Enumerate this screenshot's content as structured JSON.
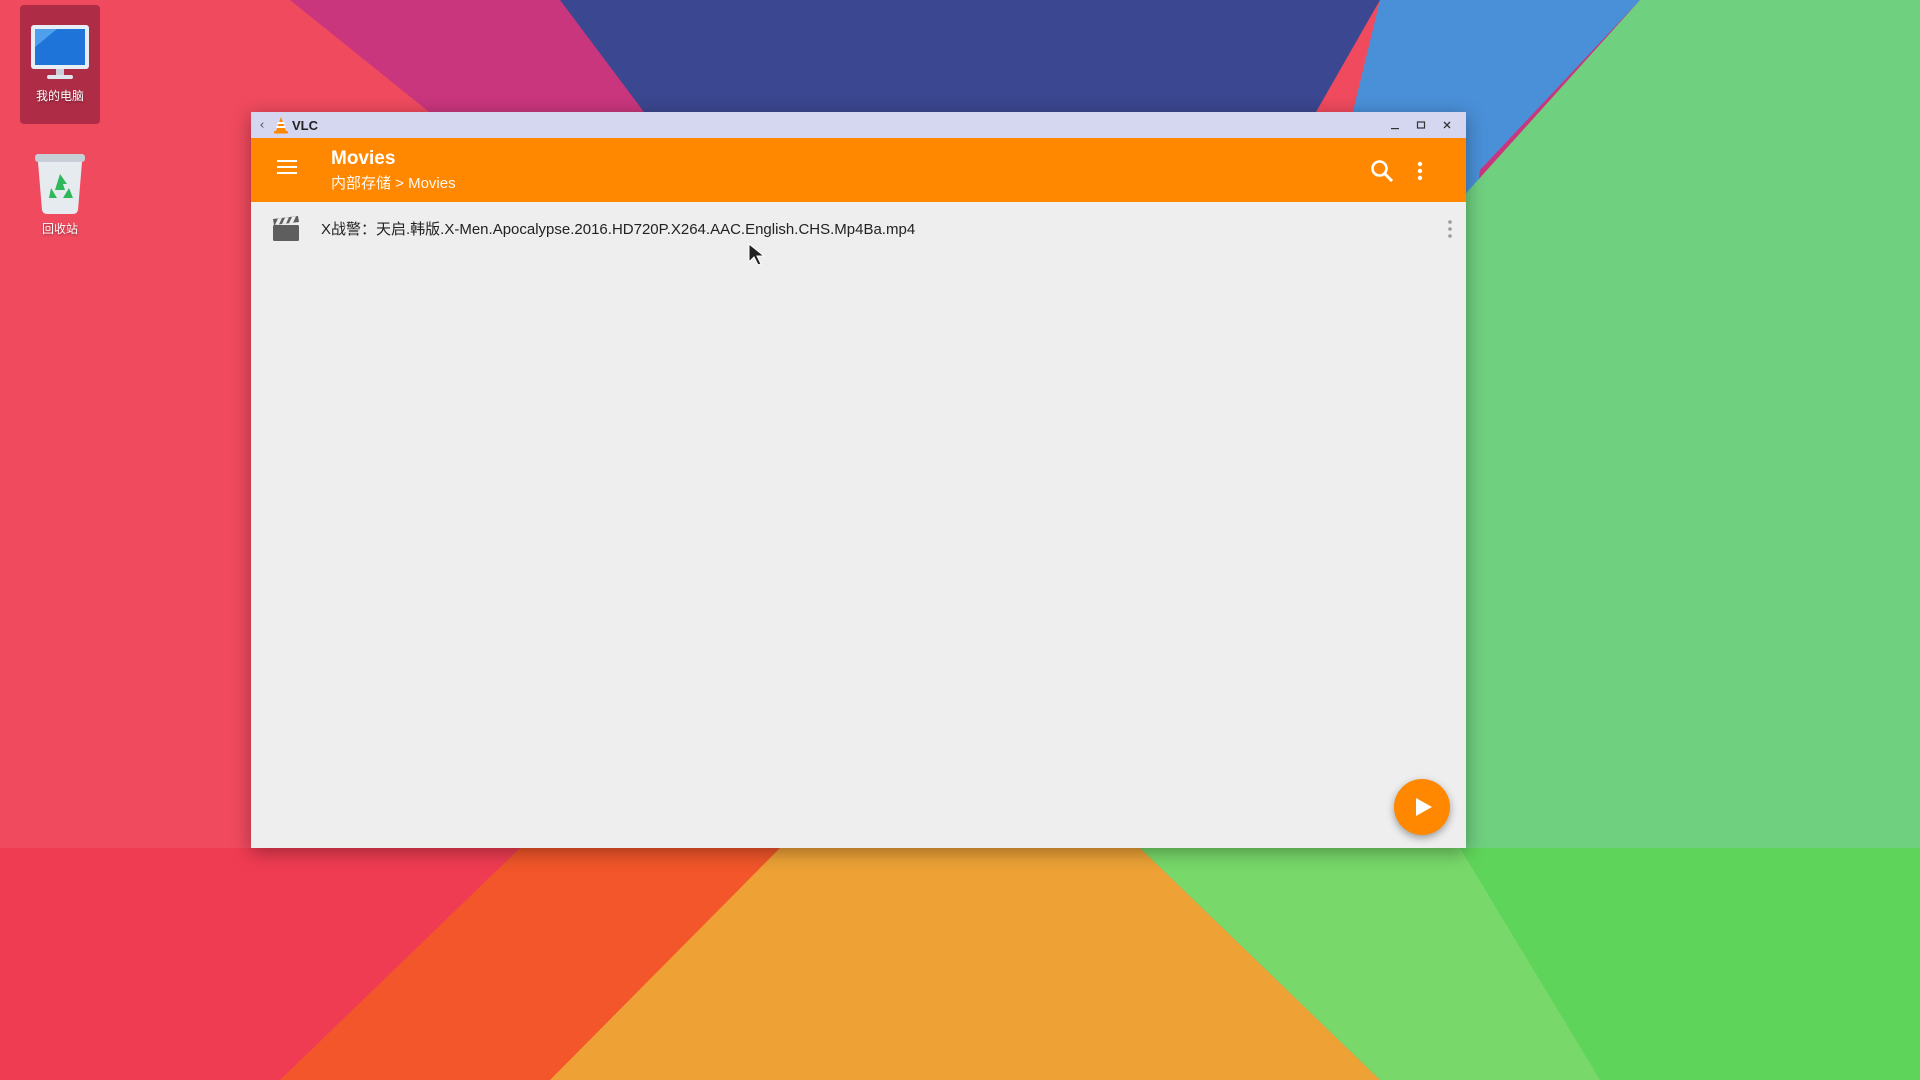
{
  "desktop": {
    "icons": [
      {
        "label": "我的电脑",
        "icon": "computer-monitor-icon"
      },
      {
        "label": "回收站",
        "icon": "recycle-bin-icon"
      }
    ]
  },
  "window": {
    "title": "VLC",
    "back_icon": "chevron-left-icon",
    "controls": [
      "minimize-icon",
      "maximize-icon",
      "close-icon"
    ]
  },
  "appbar": {
    "title": "Movies",
    "breadcrumb": "内部存储 > Movies",
    "menu_icon": "hamburger-menu-icon",
    "search_icon": "search-icon",
    "more_icon": "more-vertical-icon",
    "accent_color": "#ff8800"
  },
  "files": [
    {
      "name": "X战警：天启.韩版.X-Men.Apocalypse.2016.HD720P.X264.AAC.English.CHS.Mp4Ba.mp4",
      "icon": "movie-clapperboard-icon"
    }
  ],
  "fab": {
    "icon": "play-icon"
  }
}
